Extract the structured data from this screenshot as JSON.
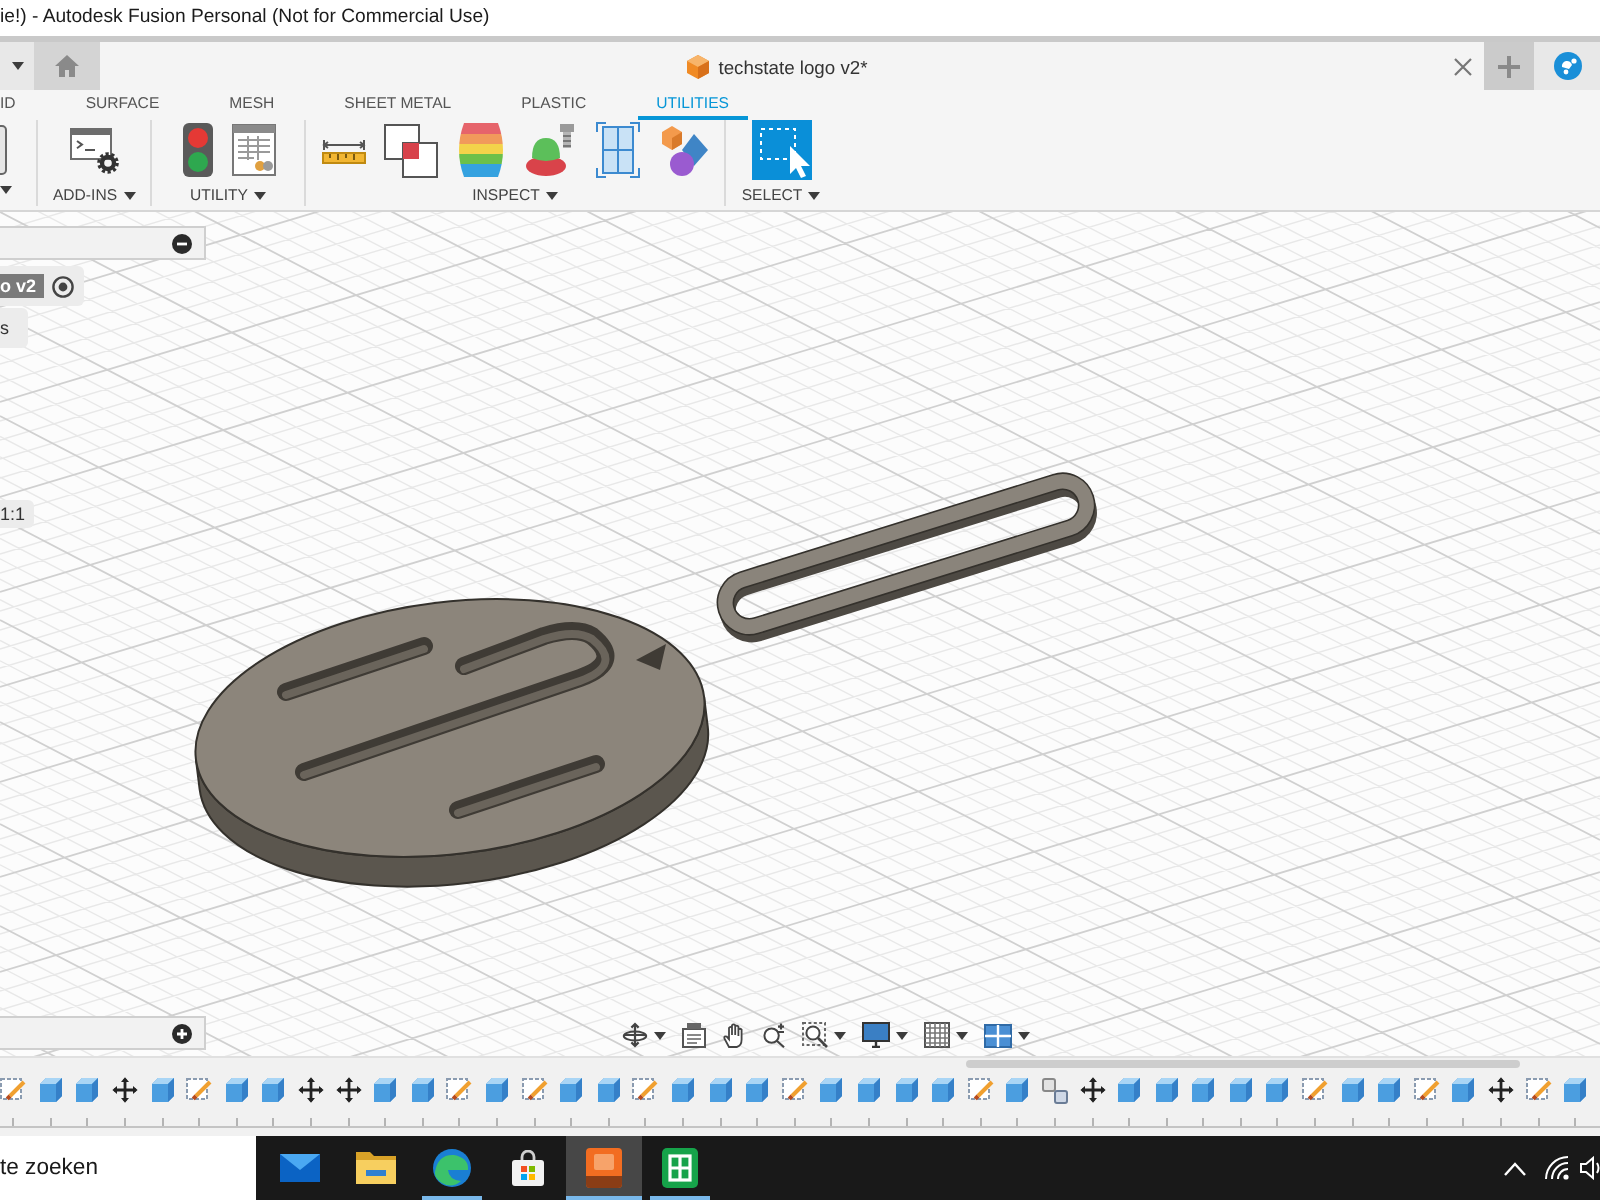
{
  "window": {
    "title": "ie!) - Autodesk Fusion Personal (Not for Commercial Use)"
  },
  "document_tab": {
    "title": "techstate logo v2*"
  },
  "ribbon": {
    "tabs": [
      {
        "label": "ID",
        "selected": false
      },
      {
        "label": "SURFACE",
        "selected": false
      },
      {
        "label": "MESH",
        "selected": false
      },
      {
        "label": "SHEET METAL",
        "selected": false
      },
      {
        "label": "PLASTIC",
        "selected": false
      },
      {
        "label": "UTILITIES",
        "selected": true
      }
    ],
    "groups": [
      {
        "tools": [
          {
            "kind": "partial"
          }
        ]
      },
      {
        "label": "ADD-INS",
        "tools": [
          {
            "kind": "scripts"
          }
        ]
      },
      {
        "label": "UTILITY",
        "tools": [
          {
            "kind": "signal"
          },
          {
            "kind": "table"
          }
        ]
      },
      {
        "label": "INSPECT",
        "tools": [
          {
            "kind": "measure"
          },
          {
            "kind": "interference"
          },
          {
            "kind": "zebra"
          },
          {
            "kind": "draft"
          },
          {
            "kind": "section"
          },
          {
            "kind": "color"
          }
        ]
      },
      {
        "label": "SELECT",
        "tools": [
          {
            "kind": "select"
          }
        ]
      }
    ]
  },
  "browser": {
    "rows": [
      {
        "label": "o v2",
        "active": true
      },
      {
        "label": "s",
        "active": false
      }
    ],
    "tag": "1:1"
  },
  "navigation_bar": [
    {
      "kind": "orbit",
      "menu": true
    },
    {
      "kind": "look",
      "menu": false
    },
    {
      "kind": "pan",
      "menu": false
    },
    {
      "kind": "zoom",
      "menu": false
    },
    {
      "kind": "fit",
      "menu": true
    },
    {
      "kind": "display",
      "menu": true
    },
    {
      "kind": "grid",
      "menu": true
    },
    {
      "kind": "viewports",
      "menu": true
    }
  ],
  "timeline": {
    "features": [
      {
        "kind": "sketch"
      },
      {
        "kind": "extrude"
      },
      {
        "kind": "extrude"
      },
      {
        "kind": "move"
      },
      {
        "kind": "extrude"
      },
      {
        "kind": "sketch"
      },
      {
        "kind": "extrude"
      },
      {
        "kind": "extrude"
      },
      {
        "kind": "move"
      },
      {
        "kind": "move"
      },
      {
        "kind": "extrude"
      },
      {
        "kind": "extrude"
      },
      {
        "kind": "sketch"
      },
      {
        "kind": "extrude"
      },
      {
        "kind": "sketch"
      },
      {
        "kind": "extrude"
      },
      {
        "kind": "extrude"
      },
      {
        "kind": "sketch"
      },
      {
        "kind": "extrude"
      },
      {
        "kind": "extrude"
      },
      {
        "kind": "extrude"
      },
      {
        "kind": "sketch"
      },
      {
        "kind": "extrude"
      },
      {
        "kind": "extrude"
      },
      {
        "kind": "extrude"
      },
      {
        "kind": "extrude"
      },
      {
        "kind": "sketch"
      },
      {
        "kind": "extrude"
      },
      {
        "kind": "joint"
      },
      {
        "kind": "move"
      },
      {
        "kind": "extrude"
      },
      {
        "kind": "extrude"
      },
      {
        "kind": "extrude"
      },
      {
        "kind": "extrude"
      },
      {
        "kind": "extrude"
      },
      {
        "kind": "sketch"
      },
      {
        "kind": "extrude"
      },
      {
        "kind": "extrude"
      },
      {
        "kind": "sketch"
      },
      {
        "kind": "extrude"
      },
      {
        "kind": "move"
      },
      {
        "kind": "sketch"
      },
      {
        "kind": "extrude"
      }
    ]
  },
  "taskbar": {
    "search": {
      "placeholder": "te zoeken"
    },
    "apps": [
      {
        "kind": "mail",
        "running": false,
        "selected": false
      },
      {
        "kind": "folder",
        "running": false,
        "selected": false
      },
      {
        "kind": "browser",
        "running": true,
        "selected": false
      },
      {
        "kind": "store",
        "running": false,
        "selected": false
      },
      {
        "kind": "fusion",
        "running": true,
        "selected": true
      },
      {
        "kind": "sheet",
        "running": true,
        "selected": false
      }
    ]
  }
}
